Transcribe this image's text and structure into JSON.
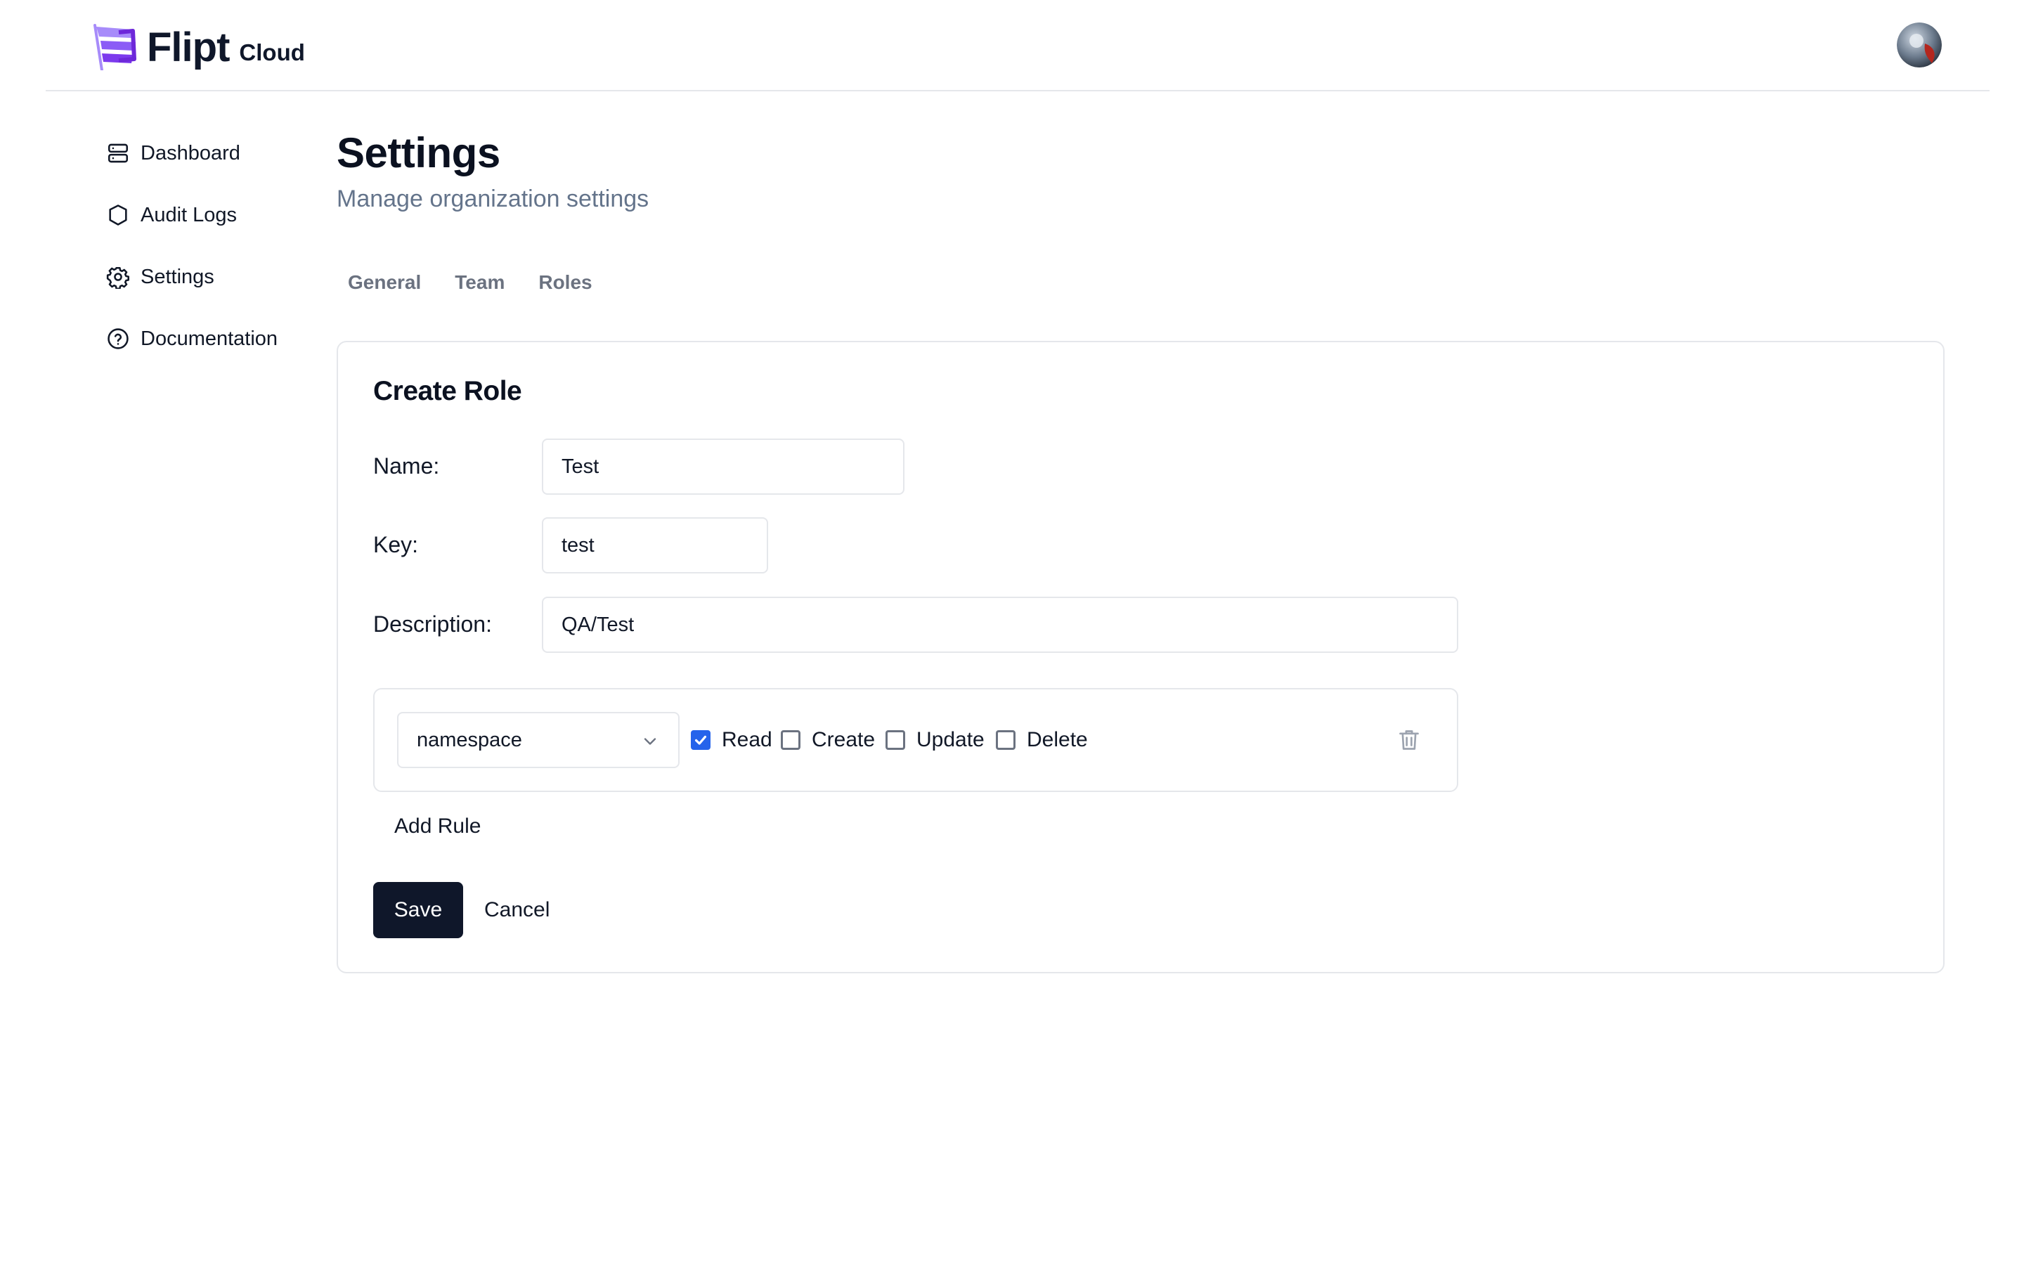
{
  "header": {
    "logo_text": "Flipt",
    "logo_suffix": "Cloud",
    "avatar_icon": "user-avatar"
  },
  "sidebar": {
    "items": [
      {
        "label": "Dashboard",
        "icon": "server-stack-icon"
      },
      {
        "label": "Audit Logs",
        "icon": "shield-icon"
      },
      {
        "label": "Settings",
        "icon": "gear-icon"
      },
      {
        "label": "Documentation",
        "icon": "help-circle-icon"
      }
    ]
  },
  "main": {
    "title": "Settings",
    "subtitle": "Manage organization settings",
    "tabs": [
      {
        "label": "General"
      },
      {
        "label": "Team"
      },
      {
        "label": "Roles"
      }
    ]
  },
  "form": {
    "title": "Create Role",
    "name_label": "Name:",
    "name_value": "Test",
    "key_label": "Key:",
    "key_value": "test",
    "description_label": "Description:",
    "description_value": "QA/Test",
    "rule": {
      "resource": "namespace",
      "permissions": [
        {
          "label": "Read",
          "checked": true
        },
        {
          "label": "Create",
          "checked": false
        },
        {
          "label": "Update",
          "checked": false
        },
        {
          "label": "Delete",
          "checked": false
        }
      ]
    },
    "add_rule_label": "Add Rule",
    "save_label": "Save",
    "cancel_label": "Cancel"
  },
  "colors": {
    "primary_button": "#0f172a",
    "checkbox_checked": "#2563eb",
    "logo_accent": "#7c3aed",
    "border": "#e5e7eb",
    "muted_text": "#64748b"
  }
}
